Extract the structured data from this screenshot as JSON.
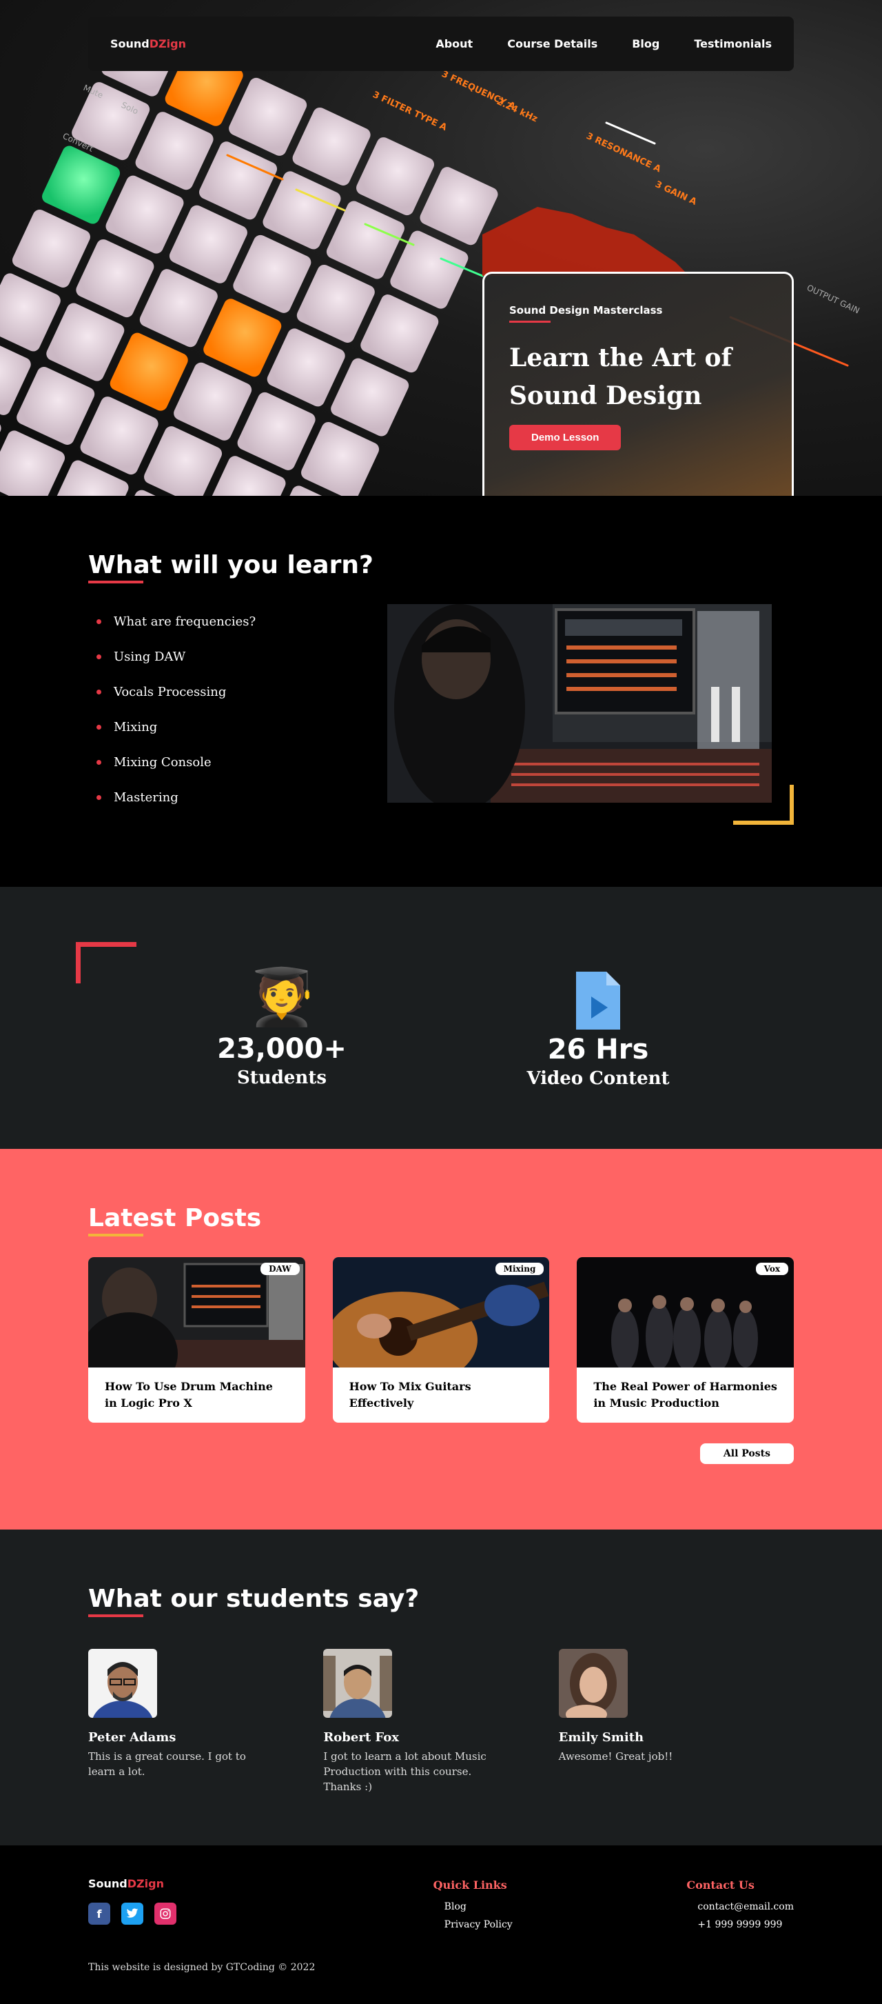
{
  "brand": {
    "part1": "Sound",
    "part2": "DZign",
    "accent": "#e63946"
  },
  "nav": {
    "links": [
      "About",
      "Course Details",
      "Blog",
      "Testimonials"
    ]
  },
  "hero": {
    "kicker": "Sound Design Masterclass",
    "title_line1": "Learn the Art of",
    "title_line2": "Sound Design",
    "cta": "Demo Lesson"
  },
  "learn": {
    "title": "What will you learn?",
    "items": [
      "What are frequencies?",
      "Using DAW",
      "Vocals Processing",
      "Mixing",
      "Mixing Console",
      "Mastering"
    ]
  },
  "stats": [
    {
      "icon": "graduate-icon",
      "glyph": "🧑‍🎓",
      "value": "23,000+",
      "label": "Students"
    },
    {
      "icon": "video-file-icon",
      "glyph": "▶",
      "value": "26 Hrs",
      "label": "Video Content"
    }
  ],
  "posts": {
    "title": "Latest Posts",
    "items": [
      {
        "tag": "DAW",
        "title": "How To Use Drum Machine in Logic Pro X"
      },
      {
        "tag": "Mixing",
        "title": "How To Mix Guitars Effectively"
      },
      {
        "tag": "Vox",
        "title": "The Real Power of Harmonies in Music Production"
      }
    ],
    "all_label": "All Posts",
    "bg": "#ff6464"
  },
  "testimonials": {
    "title": "What our students say?",
    "items": [
      {
        "name": "Peter Adams",
        "text": "This is a great course. I got to learn a lot."
      },
      {
        "name": "Robert Fox",
        "text": "I got to learn a lot about Music Production with this course. Thanks :)"
      },
      {
        "name": "Emily Smith",
        "text": "Awesome! Great job!!"
      }
    ]
  },
  "footer": {
    "quick_title": "Quick Links",
    "quick_links": [
      "Blog",
      "Privacy Policy"
    ],
    "contact_title": "Contact Us",
    "contact": [
      "contact@email.com",
      "+1 999 9999 999"
    ],
    "socials": [
      "facebook-icon",
      "twitter-icon",
      "instagram-icon"
    ],
    "credit": "This website is designed by GTCoding © 2022"
  }
}
